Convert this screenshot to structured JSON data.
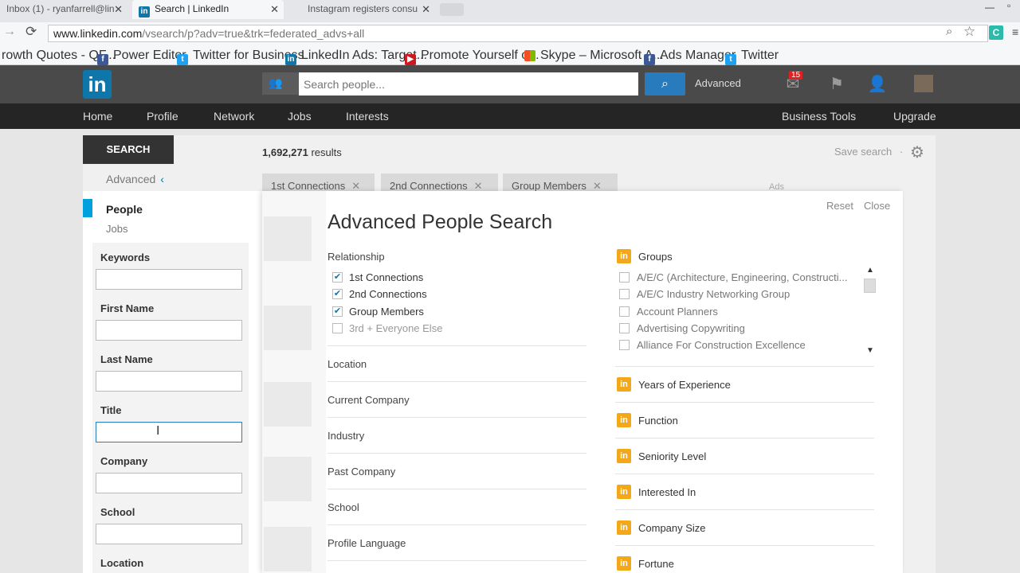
{
  "browser": {
    "tabs": [
      {
        "title": "Inbox (1) - ryanfarrell@lin"
      },
      {
        "title": "Search | LinkedIn"
      },
      {
        "title": "Instagram registers consu"
      }
    ],
    "url_host": "www.linkedin.com",
    "url_path": "/vsearch/p?adv=true&trk=federated_advs+all",
    "bookmarks": [
      {
        "label": "rowth Quotes - QF..."
      },
      {
        "label": "Power Editor"
      },
      {
        "label": "Twitter for Business"
      },
      {
        "label": "LinkedIn Ads: Target..."
      },
      {
        "label": "Promote Yourself o..."
      },
      {
        "label": "Skype – Microsoft A..."
      },
      {
        "label": "Ads Manager"
      },
      {
        "label": "Twitter"
      }
    ]
  },
  "header": {
    "logo": "in",
    "search_placeholder": "Search people...",
    "advanced": "Advanced",
    "notification_count": "15"
  },
  "nav": {
    "items": [
      "Home",
      "Profile",
      "Network",
      "Jobs",
      "Interests"
    ],
    "business_tools": "Business Tools",
    "upgrade": "Upgrade"
  },
  "sidebar": {
    "search_tab": "SEARCH",
    "advanced": "Advanced",
    "people": "People",
    "jobs": "Jobs",
    "fields": [
      "Keywords",
      "First Name",
      "Last Name",
      "Title",
      "Company",
      "School",
      "Location"
    ]
  },
  "results": {
    "count": "1,692,271",
    "suffix": "results",
    "save_search": "Save search",
    "chips": [
      "1st Connections",
      "2nd Connections",
      "Group Members"
    ],
    "ads_label": "Ads"
  },
  "advanced_search": {
    "title": "Advanced People Search",
    "reset": "Reset",
    "close": "Close",
    "relationship_label": "Relationship",
    "relationship": [
      {
        "label": "1st Connections",
        "checked": true
      },
      {
        "label": "2nd Connections",
        "checked": true
      },
      {
        "label": "Group Members",
        "checked": true
      },
      {
        "label": "3rd + Everyone Else",
        "checked": false
      }
    ],
    "sections": [
      "Location",
      "Current Company",
      "Industry",
      "Past Company",
      "School",
      "Profile Language"
    ],
    "groups_label": "Groups",
    "groups": [
      "A/E/C (Architecture, Engineering, Constructi...",
      "A/E/C Industry Networking Group",
      "Account Planners",
      "Advertising Copywriting",
      "Alliance For Construction Excellence"
    ],
    "premium_sections": [
      "Years of Experience",
      "Function",
      "Seniority Level",
      "Interested In",
      "Company Size",
      "Fortune"
    ]
  }
}
